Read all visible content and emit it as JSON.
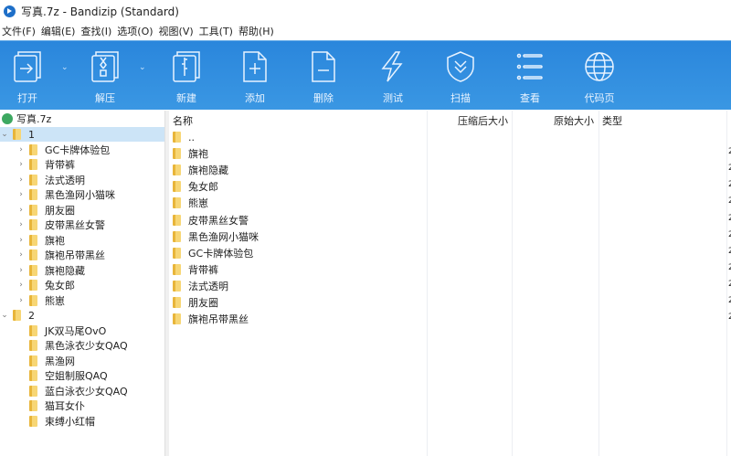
{
  "title": "写真.7z - Bandizip (Standard)",
  "menu": [
    "文件(F)",
    "编辑(E)",
    "查找(I)",
    "选项(O)",
    "视图(V)",
    "工具(T)",
    "帮助(H)"
  ],
  "toolbar": {
    "open": "打开",
    "extract": "解压",
    "new": "新建",
    "add": "添加",
    "delete": "删除",
    "test": "测试",
    "scan": "扫描",
    "view": "查看",
    "codepage": "代码页"
  },
  "tree": {
    "root": "写真.7z",
    "folder1": {
      "label": "1",
      "children": [
        "GC卡牌体验包",
        "背带裤",
        "法式透明",
        "黑色渔网小猫咪",
        "朋友圈",
        "皮带黑丝女警",
        "旗袍",
        "旗袍吊带黑丝",
        "旗袍隐藏",
        "兔女郎",
        "熊崽"
      ]
    },
    "folder2": {
      "label": "2",
      "children": [
        "JK双马尾OvO",
        "黑色泳衣少女QAQ",
        "黑渔网",
        "空姐制服QAQ",
        "蓝白泳衣少女QAQ",
        "猫耳女仆",
        "束缚小红帽"
      ]
    }
  },
  "list": {
    "headers": {
      "name": "名称",
      "compressed": "压缩后大小",
      "original": "原始大小",
      "type": "类型"
    },
    "rows": [
      "..",
      "旗袍",
      "旗袍隐藏",
      "兔女郎",
      "熊崽",
      "皮带黑丝女警",
      "黑色渔网小猫咪",
      "GC卡牌体验包",
      "背带裤",
      "法式透明",
      "朋友圈",
      "旗袍吊带黑丝"
    ],
    "truncated_col_char": "2"
  },
  "colors": {
    "toolbar": "#2a86dc",
    "selection": "#cce4f7"
  }
}
